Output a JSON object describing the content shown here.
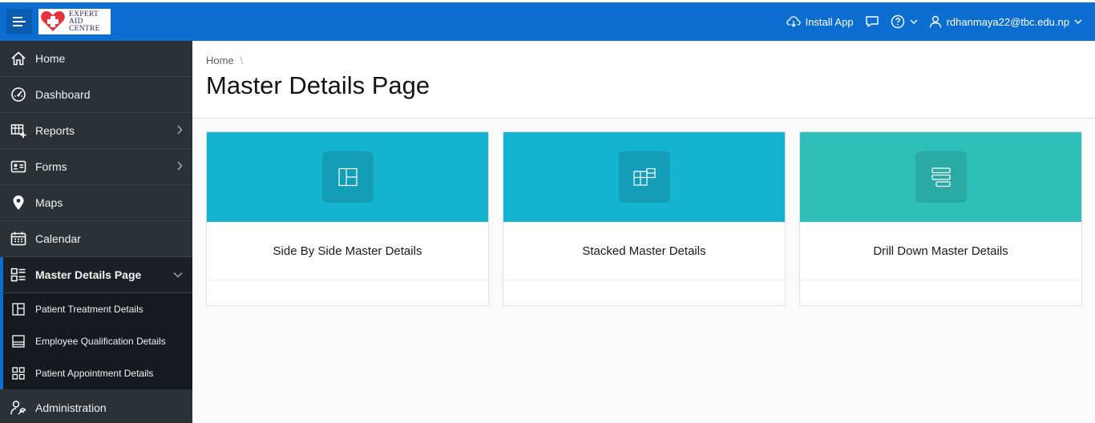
{
  "header": {
    "logo_text": [
      "EXPERT",
      "AID",
      "CENTRE"
    ],
    "install_app": "Install App",
    "user_email": "rdhanmaya22@tbc.edu.np",
    "icons": {
      "menu": "hamburger-icon",
      "install": "cloud-download-icon",
      "feedback": "chat-bubble-icon",
      "help": "question-circle-icon",
      "user": "user-icon"
    },
    "bg_color": "#0c6ed1"
  },
  "sidebar": {
    "items": [
      {
        "label": "Home",
        "icon": "home-icon"
      },
      {
        "label": "Dashboard",
        "icon": "gauge-icon"
      },
      {
        "label": "Reports",
        "icon": "table-add-icon",
        "has_children": true
      },
      {
        "label": "Forms",
        "icon": "id-card-icon",
        "has_children": true
      },
      {
        "label": "Maps",
        "icon": "map-pin-icon"
      },
      {
        "label": "Calendar",
        "icon": "calendar-icon"
      },
      {
        "label": "Master Details Page",
        "icon": "master-detail-icon",
        "expanded": true,
        "active": true
      },
      {
        "label": "Administration",
        "icon": "user-wrench-icon"
      }
    ],
    "sub_items": [
      {
        "label": "Patient Treatment Details",
        "icon": "split-columns-icon"
      },
      {
        "label": "Employee Qualification Details",
        "icon": "stacked-panel-icon"
      },
      {
        "label": "Patient Appointment Details",
        "icon": "grid-icon"
      }
    ]
  },
  "main": {
    "breadcrumb": "Home",
    "breadcrumb_sep": "\\",
    "title": "Master Details Page",
    "cards": [
      {
        "label": "Side By Side Master Details",
        "icon": "side-by-side-icon",
        "color": "#14b4d0"
      },
      {
        "label": "Stacked Master Details",
        "icon": "stacked-icon",
        "color": "#14b4d0"
      },
      {
        "label": "Drill Down Master Details",
        "icon": "drill-down-icon",
        "color": "#2ebfb8"
      }
    ]
  }
}
